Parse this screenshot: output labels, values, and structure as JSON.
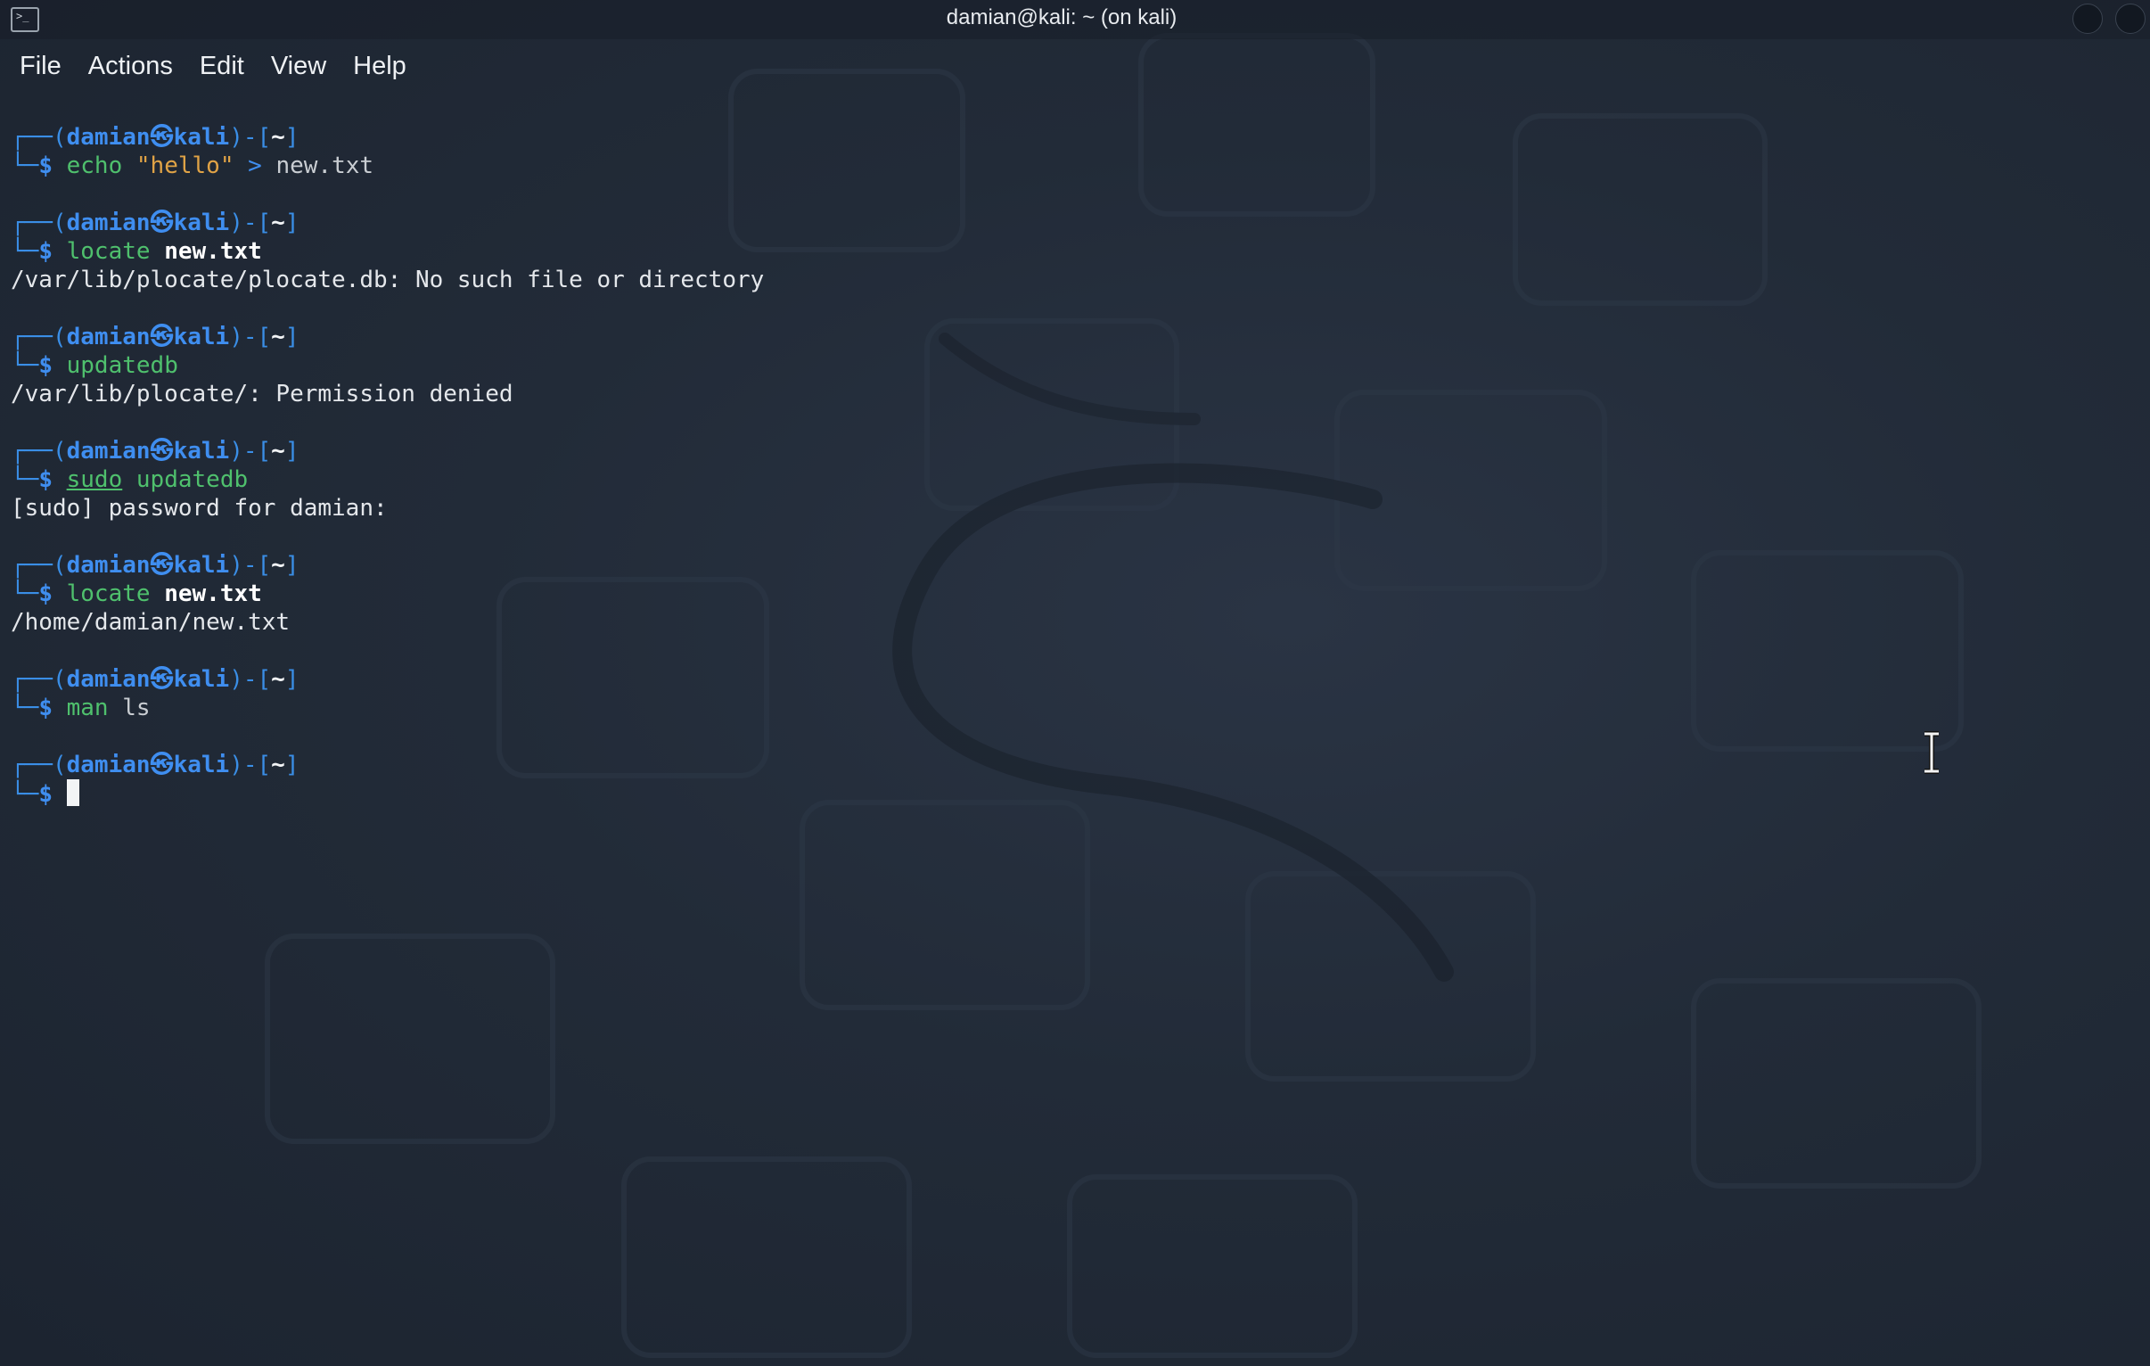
{
  "window": {
    "title": "damian@kali: ~ (on kali)",
    "icon": "terminal-icon"
  },
  "menu": {
    "items": [
      "File",
      "Actions",
      "Edit",
      "View",
      "Help"
    ]
  },
  "prompt": {
    "user": "damian",
    "host": "kali",
    "dir": "~",
    "symbol": "$"
  },
  "terminal": {
    "blocks": [
      {
        "command": [
          "echo",
          "\"hello\"",
          ">",
          "new.txt"
        ],
        "output": []
      },
      {
        "command": [
          "locate",
          "new.txt"
        ],
        "output": [
          "/var/lib/plocate/plocate.db: No such file or directory"
        ]
      },
      {
        "command": [
          "updatedb"
        ],
        "output": [
          "/var/lib/plocate/: Permission denied"
        ]
      },
      {
        "command": [
          "sudo",
          "updatedb"
        ],
        "output": [
          "[sudo] password for damian:"
        ]
      },
      {
        "command": [
          "locate",
          "new.txt"
        ],
        "output": [
          "/home/damian/new.txt"
        ]
      },
      {
        "command": [
          "man",
          "ls"
        ],
        "output": []
      },
      {
        "command": [],
        "output": []
      }
    ]
  },
  "colors": {
    "prompt_blue": "#3f8ef0",
    "command_green": "#4fc06d",
    "string_orange": "#e0a346",
    "background": "#222b38"
  }
}
